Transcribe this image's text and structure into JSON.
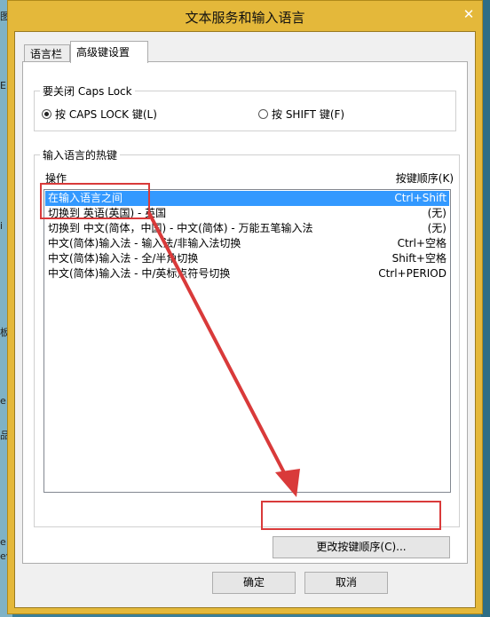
{
  "background": {
    "left_fragments": [
      "图",
      "E",
      "i",
      "板",
      "e",
      "品",
      "e",
      "ev"
    ]
  },
  "window": {
    "title": "文本服务和输入语言",
    "close_glyph": "✕"
  },
  "tabs": [
    {
      "label": "语言栏",
      "active": false
    },
    {
      "label": "高级键设置",
      "active": true
    }
  ],
  "caps_lock": {
    "legend": "要关闭 Caps Lock",
    "options": [
      {
        "label": "按 CAPS LOCK 键(L)",
        "checked": true
      },
      {
        "label": "按 SHIFT 键(F)",
        "checked": false
      }
    ]
  },
  "hotkeys": {
    "legend": "输入语言的热键",
    "col_action": "操作",
    "col_key": "按键顺序(K)",
    "rows": [
      {
        "action": "在输入语言之间",
        "key": "Ctrl+Shift",
        "selected": true
      },
      {
        "action": "切换到 英语(英国) - 英国",
        "key": "(无)",
        "selected": false
      },
      {
        "action": "切换到 中文(简体，中国) - 中文(简体) - 万能五笔输入法",
        "key": "(无)",
        "selected": false
      },
      {
        "action": "中文(简体)输入法 - 输入法/非输入法切换",
        "key": "Ctrl+空格",
        "selected": false
      },
      {
        "action": "中文(简体)输入法 - 全/半角切换",
        "key": "Shift+空格",
        "selected": false
      },
      {
        "action": "中文(简体)输入法 - 中/英标点符号切换",
        "key": "Ctrl+PERIOD",
        "selected": false
      }
    ],
    "change_button": "更改按键顺序(C)..."
  },
  "footer": {
    "ok": "确定",
    "cancel": "取消"
  },
  "colors": {
    "title_bar": "#e4b83a",
    "selection": "#3399ff",
    "annotation": "#d93a3a"
  }
}
